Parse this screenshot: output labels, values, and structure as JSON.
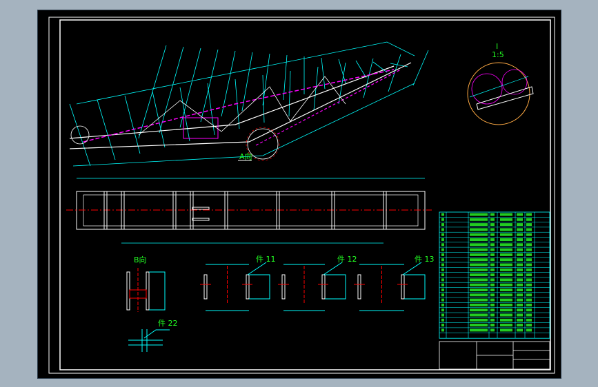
{
  "drawing": {
    "labels": {
      "view_a": "A向",
      "view_b": "B向",
      "detail_mark": "I",
      "detail_scale": "1:5",
      "part_11": "件 11",
      "part_12": "件 12",
      "part_13": "件 13",
      "part_22": "件 22"
    },
    "colors": {
      "background": "#000000",
      "frame": "#ffffff",
      "outline": "#00ffff",
      "center_line": "#ff0000",
      "hidden": "#ff00ff",
      "text": "#22ff22",
      "detail_circle": "#ffaa44"
    },
    "bom_rows": 24
  }
}
